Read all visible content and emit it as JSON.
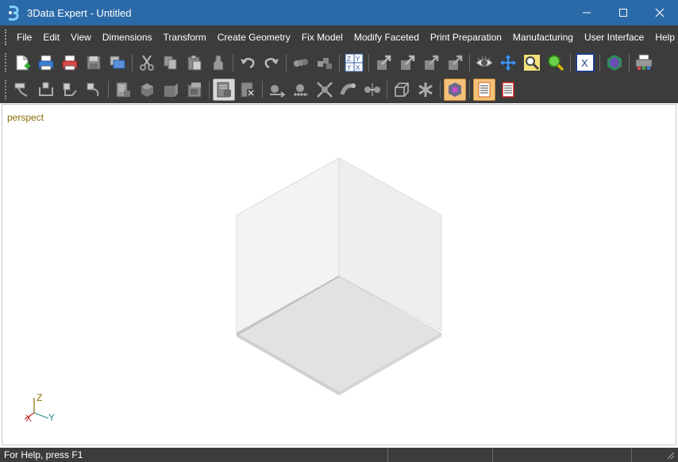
{
  "window": {
    "title": "3Data Expert - Untitled",
    "controls": [
      "minimize",
      "maximize",
      "close"
    ]
  },
  "menu": {
    "items": [
      "File",
      "Edit",
      "View",
      "Dimensions",
      "Transform",
      "Create Geometry",
      "Fix Model",
      "Modify Faceted",
      "Print Preparation",
      "Manufacturing",
      "User Interface",
      "Help"
    ]
  },
  "toolbar1": {
    "icons": [
      "new-file-icon",
      "print-icon",
      "print-preview-icon",
      "save-icon",
      "save-all-icon",
      "cut-icon",
      "copy-icon",
      "paste-icon",
      "clear-icon",
      "undo-icon",
      "redo-icon",
      "group-icon",
      "ungroup-icon",
      "axis-swap-icon",
      "move-icon",
      "rotate-icon",
      "scale-icon",
      "mirror-icon",
      "eye-icon",
      "pan-icon",
      "zoom-icon",
      "zoom-fit-icon",
      "x-axis-icon",
      "shade-icon",
      "printer-3d-icon"
    ]
  },
  "toolbar2": {
    "icons": [
      "dim-linear-icon",
      "dim-angular-icon",
      "dim-radial-icon",
      "dim-arc-icon",
      "report-icon",
      "solid-icon",
      "box-icon",
      "section-icon",
      "layer-icon",
      "layer-delete-icon",
      "transform-icon",
      "align-icon",
      "explode-icon",
      "sweep-icon",
      "join-icon",
      "wire-box-icon",
      "asterisk-icon",
      "color-mode-icon",
      "sheet-orange-icon",
      "sheet-red-icon"
    ]
  },
  "viewport": {
    "projection_label": "perspect",
    "axis_labels": {
      "z": "Z",
      "x": "X",
      "y": "Y"
    }
  },
  "status": {
    "help_text": "For Help, press F1"
  }
}
